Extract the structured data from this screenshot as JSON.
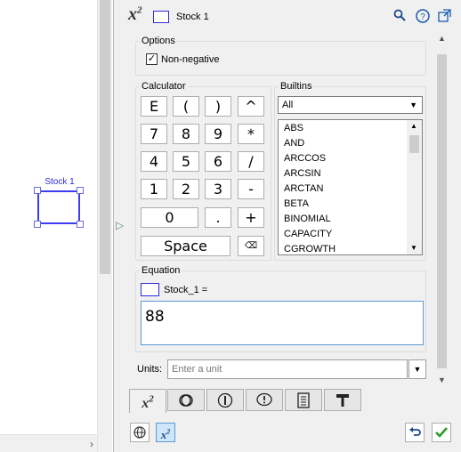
{
  "canvas": {
    "stock_label": "Stock 1"
  },
  "header": {
    "variable_name": "Stock 1",
    "equation_icon": "x2",
    "icons": [
      "search-icon",
      "help-icon",
      "popout-icon"
    ]
  },
  "options": {
    "legend": "Options",
    "nonnegative_label": "Non-negative",
    "nonnegative_checked": true
  },
  "calculator": {
    "legend": "Calculator",
    "keys": [
      "E",
      "(",
      ")",
      "^",
      "7",
      "8",
      "9",
      "*",
      "4",
      "5",
      "6",
      "/",
      "1",
      "2",
      "3",
      "-",
      "0",
      ".",
      "+",
      "Space"
    ],
    "backspace_icon": "backspace-icon"
  },
  "builtins": {
    "legend": "Builtins",
    "filter": "All",
    "items": [
      "ABS",
      "AND",
      "ARCCOS",
      "ARCSIN",
      "ARCTAN",
      "BETA",
      "BINOMIAL",
      "CAPACITY",
      "CGROWTH"
    ]
  },
  "equation": {
    "legend": "Equation",
    "prefix": "Stock_1 =",
    "value": "88"
  },
  "units": {
    "label": "Units:",
    "placeholder": "Enter a unit"
  },
  "tabs": [
    "equation-tab",
    "display-tab",
    "info-tab",
    "validation-tab",
    "notes-tab",
    "style-tab"
  ],
  "bottom": {
    "left_icons": [
      "globe-icon",
      "equation-icon"
    ],
    "right_icons": [
      "undo-icon",
      "apply-icon"
    ]
  }
}
